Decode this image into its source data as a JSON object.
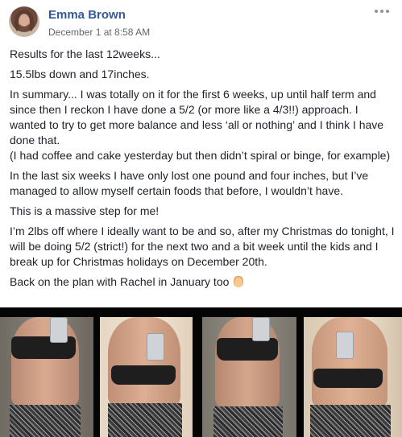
{
  "post": {
    "author": "Emma Brown",
    "timestamp": "December 1 at 8:58 AM",
    "paragraphs": [
      "Results for the last 12weeks...",
      "15.5lbs down and 17inches.",
      "In summary... I was totally on it for the first 6 weeks, up until half term and since then I reckon I have done a 5/2 (or more like a 4/3!!) approach. I wanted to try to get more balance and less ‘all or nothing’ and I think I have done that.\n(I had coffee and cake yesterday but then didn’t spiral or binge, for example)",
      "In the last six weeks I have only lost one pound and four inches, but I’ve managed to allow myself certain foods that before, I wouldn’t have.",
      "This is a massive step for me!",
      "I’m 2lbs off where I ideally want to be and so, after my Christmas do tonight, I will be doing 5/2 (strict!) for the next two and a bit week until the kids and I break up for Christmas holidays on December 20th.",
      "Back on the plan with Rachel in January too"
    ],
    "emoji_icon": "fingers-crossed-emoji",
    "photos_count_shown": 4
  },
  "colors": {
    "author_link": "#365899",
    "meta_text": "#616770",
    "body_text": "#1d2129",
    "photo_background": "#050505"
  }
}
